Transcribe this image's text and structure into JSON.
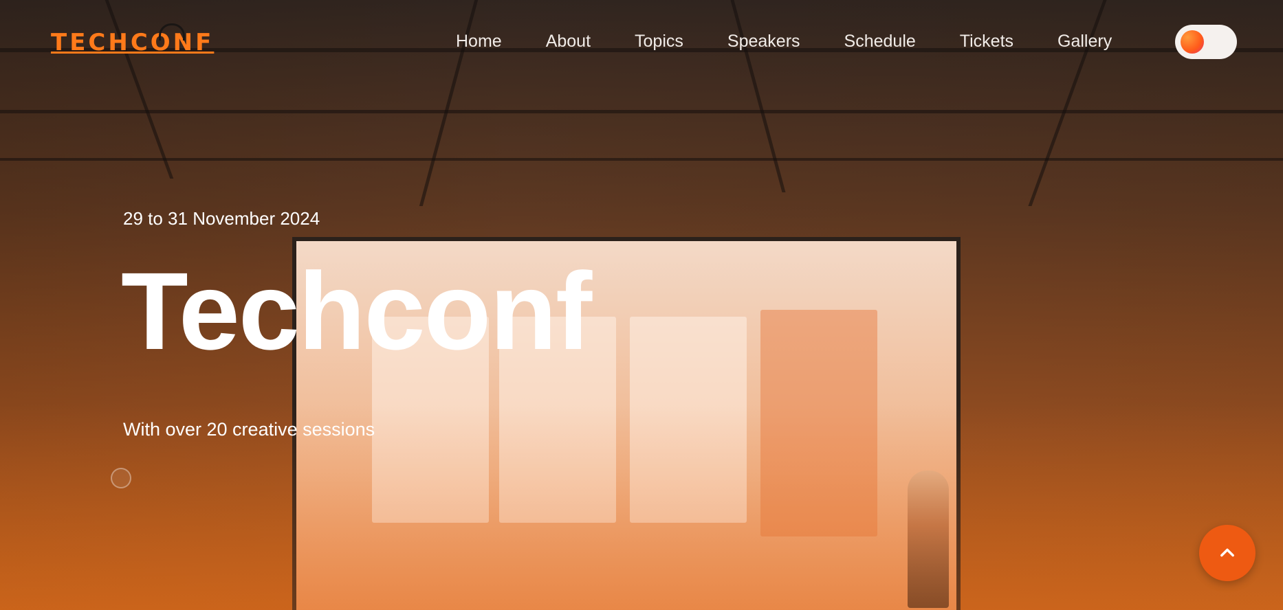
{
  "brand": {
    "logo_text": "TECHCONF"
  },
  "nav": {
    "items": [
      {
        "label": "Home"
      },
      {
        "label": "About"
      },
      {
        "label": "Topics"
      },
      {
        "label": "Speakers"
      },
      {
        "label": "Schedule"
      },
      {
        "label": "Tickets"
      },
      {
        "label": "Gallery"
      }
    ]
  },
  "theme_toggle": {
    "icon": "theme-toggle-icon",
    "state": "light"
  },
  "hero": {
    "date": "29 to 31 November 2024",
    "title": "Techconf",
    "subtitle": "With over 20 creative sessions"
  },
  "colors": {
    "accent": "#ff7a1a",
    "button": "#ee5a12",
    "text": "#ffffff"
  },
  "back_to_top": {
    "icon": "chevron-up-icon"
  }
}
